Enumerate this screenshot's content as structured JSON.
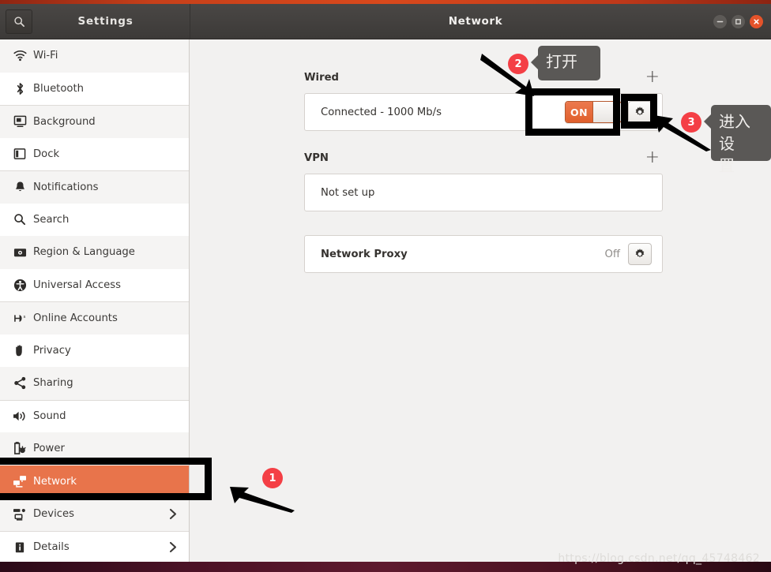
{
  "window": {
    "sidebar_title": "Settings",
    "main_title": "Network",
    "search_icon": "search-icon",
    "controls": {
      "minimize": "minimize-icon",
      "maximize": "maximize-icon",
      "close": "close-icon"
    }
  },
  "sidebar": {
    "items": [
      {
        "label": "Wi-Fi",
        "icon": "wifi-icon",
        "selected": false,
        "chevron": false
      },
      {
        "label": "Bluetooth",
        "icon": "bluetooth-icon",
        "selected": false,
        "chevron": false
      },
      {
        "label": "Background",
        "icon": "background-icon",
        "selected": false,
        "chevron": false
      },
      {
        "label": "Dock",
        "icon": "dock-icon",
        "selected": false,
        "chevron": false
      },
      {
        "label": "Notifications",
        "icon": "bell-icon",
        "selected": false,
        "chevron": false
      },
      {
        "label": "Search",
        "icon": "search-icon",
        "selected": false,
        "chevron": false
      },
      {
        "label": "Region & Language",
        "icon": "region-language-icon",
        "selected": false,
        "chevron": false
      },
      {
        "label": "Universal Access",
        "icon": "universal-access-icon",
        "selected": false,
        "chevron": false
      },
      {
        "label": "Online Accounts",
        "icon": "online-accounts-icon",
        "selected": false,
        "chevron": false
      },
      {
        "label": "Privacy",
        "icon": "privacy-hand-icon",
        "selected": false,
        "chevron": false
      },
      {
        "label": "Sharing",
        "icon": "sharing-icon",
        "selected": false,
        "chevron": false
      },
      {
        "label": "Sound",
        "icon": "sound-icon",
        "selected": false,
        "chevron": false
      },
      {
        "label": "Power",
        "icon": "power-battery-icon",
        "selected": false,
        "chevron": false
      },
      {
        "label": "Network",
        "icon": "network-icon",
        "selected": true,
        "chevron": false
      },
      {
        "label": "Devices",
        "icon": "devices-icon",
        "selected": false,
        "chevron": true
      },
      {
        "label": "Details",
        "icon": "details-info-icon",
        "selected": false,
        "chevron": true
      }
    ]
  },
  "main": {
    "wired": {
      "title": "Wired",
      "add_label": "+",
      "status": "Connected - 1000 Mb/s",
      "toggle_state": "ON",
      "gear_icon": "gear-icon"
    },
    "vpn": {
      "title": "VPN",
      "add_label": "+",
      "status": "Not set up"
    },
    "proxy": {
      "title": "Network Proxy",
      "state": "Off",
      "gear_icon": "gear-icon"
    }
  },
  "annotations": {
    "badges": [
      {
        "number": "1"
      },
      {
        "number": "2"
      },
      {
        "number": "3"
      }
    ],
    "tooltips": [
      {
        "id": "tip-open",
        "text": "打开"
      },
      {
        "id": "tip-settings",
        "text": "进入设\n置"
      }
    ],
    "tooltip_open": "打开",
    "tooltip_settings_line1": "进入设",
    "tooltip_settings_line2": "置",
    "highlight_color": "#000000",
    "badge_color": "#f43f45",
    "tooltip_bg": "#5a5856"
  },
  "watermark": "https://blog.csdn.net/qq_45748462",
  "colors": {
    "accent": "#e8744b",
    "toggle_on": "#e05f2c",
    "titlebar": "#403d3b",
    "sidebar_bg": "#ffffff",
    "main_bg": "#f2f1f0"
  }
}
